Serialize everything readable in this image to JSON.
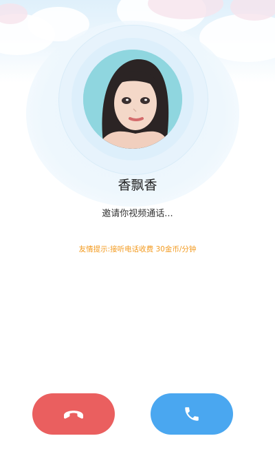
{
  "caller": {
    "name": "香飘香",
    "status": "邀请你视频通话...",
    "tip": "友情提示:接听电话收费 30金币/分钟"
  },
  "actions": {
    "decline_icon": "hang-up-icon",
    "accept_icon": "phone-icon"
  },
  "colors": {
    "decline": "#ea5f5f",
    "accept": "#4aa7f0",
    "tip": "#f39a1e",
    "name": "#222222"
  }
}
